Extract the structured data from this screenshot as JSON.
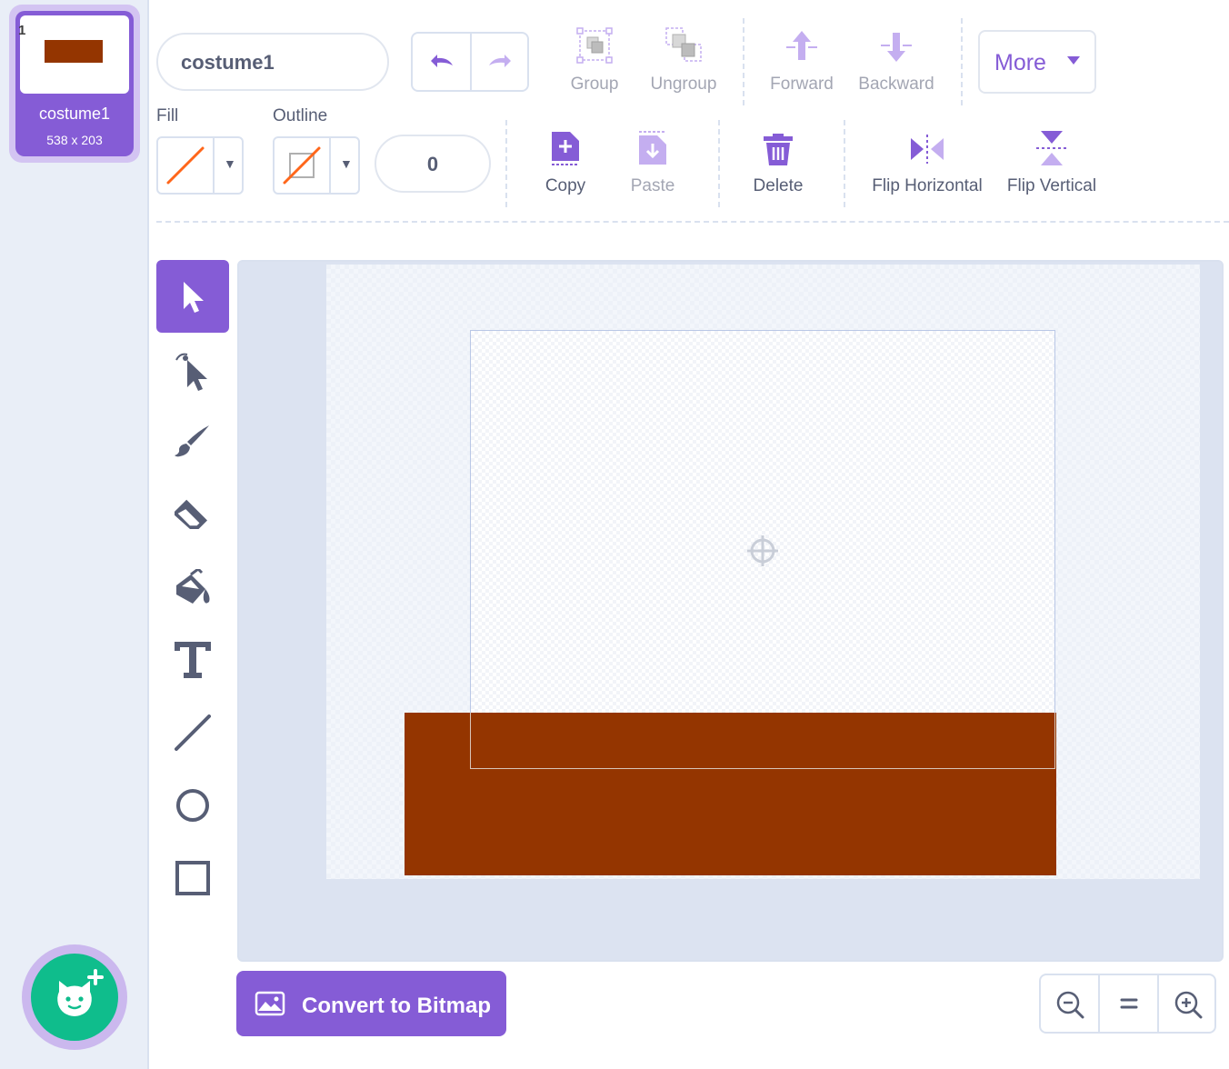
{
  "colors": {
    "accent": "#855cd6",
    "shape_fill": "#943500",
    "add_button": "#0fbd8c",
    "text": "#575e75"
  },
  "sidebar": {
    "costume": {
      "index": "1",
      "name": "costume1",
      "size": "538 x 203"
    },
    "add_costume_icon": "cat-add-icon"
  },
  "toolbar": {
    "costume_name": "costume1",
    "undo_icon": "undo-icon",
    "redo_icon": "redo-icon",
    "group_label": "Group",
    "ungroup_label": "Ungroup",
    "forward_label": "Forward",
    "backward_label": "Backward",
    "more_label": "More",
    "fill_label": "Fill",
    "outline_label": "Outline",
    "stroke_width": "0",
    "copy_label": "Copy",
    "paste_label": "Paste",
    "delete_label": "Delete",
    "flip_horizontal_label": "Flip Horizontal",
    "flip_vertical_label": "Flip Vertical"
  },
  "tools": [
    "select",
    "reshape",
    "brush",
    "eraser",
    "fill",
    "text",
    "line",
    "circle",
    "rectangle"
  ],
  "canvas": {
    "crosshair_icon": "crosshair-icon"
  },
  "footer": {
    "convert_label": "Convert to Bitmap",
    "zoom_out_icon": "zoom-out-icon",
    "zoom_reset_icon": "zoom-reset-icon",
    "zoom_in_icon": "zoom-in-icon"
  }
}
